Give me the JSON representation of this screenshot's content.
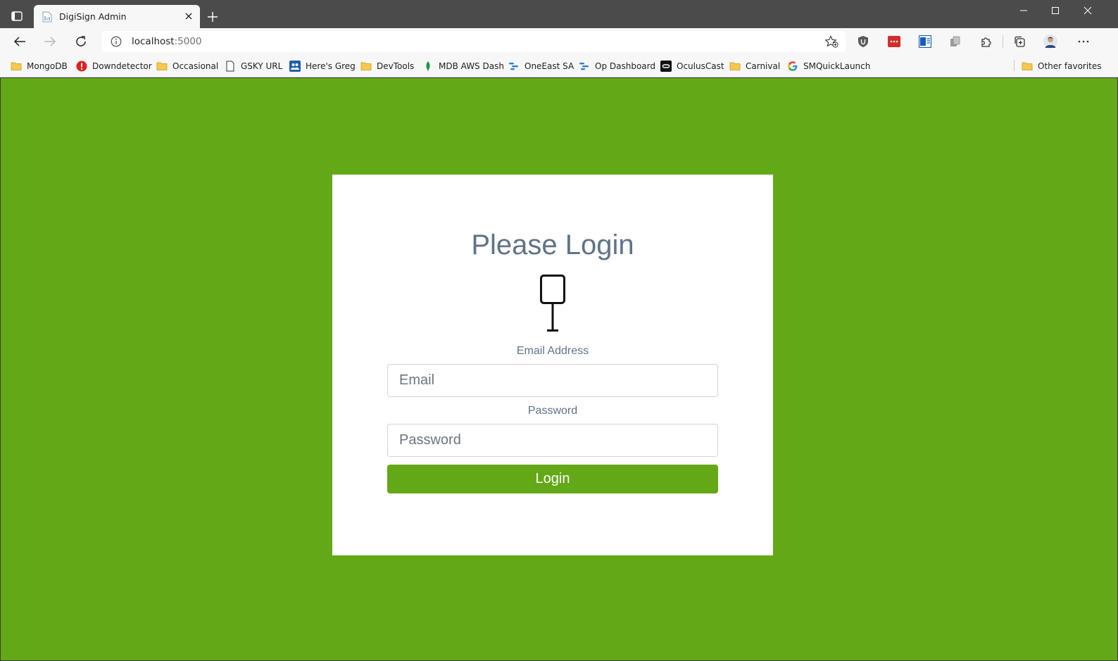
{
  "browser": {
    "tab": {
      "title": "DigiSign Admin"
    },
    "address": {
      "host": "localhost",
      "port": ":5000"
    },
    "bookmarks": [
      {
        "label": "MongoDB",
        "icon": "folder-icon"
      },
      {
        "label": "Downdetector",
        "icon": "downdetector-icon"
      },
      {
        "label": "Occasional",
        "icon": "folder-icon"
      },
      {
        "label": "GSKY URL",
        "icon": "page-icon"
      },
      {
        "label": "Here's Greg",
        "icon": "people-icon"
      },
      {
        "label": "DevTools",
        "icon": "folder-icon"
      },
      {
        "label": "MDB AWS Dash",
        "icon": "mongodb-leaf-icon"
      },
      {
        "label": "OneEast SA",
        "icon": "flow-icon"
      },
      {
        "label": "Op Dashboard",
        "icon": "flow-icon"
      },
      {
        "label": "OculusCast",
        "icon": "oculus-icon"
      },
      {
        "label": "Carnival",
        "icon": "folder-icon"
      },
      {
        "label": "SMQuickLaunch",
        "icon": "google-icon"
      }
    ],
    "other_favorites": "Other favorites"
  },
  "login": {
    "title": "Please Login",
    "email_label": "Email Address",
    "email_placeholder": "Email",
    "password_label": "Password",
    "password_placeholder": "Password",
    "submit_label": "Login"
  },
  "colors": {
    "page_background": "#63a917",
    "button_background": "#63a917",
    "heading_text": "#5f7389",
    "card_background": "#ffffff"
  }
}
